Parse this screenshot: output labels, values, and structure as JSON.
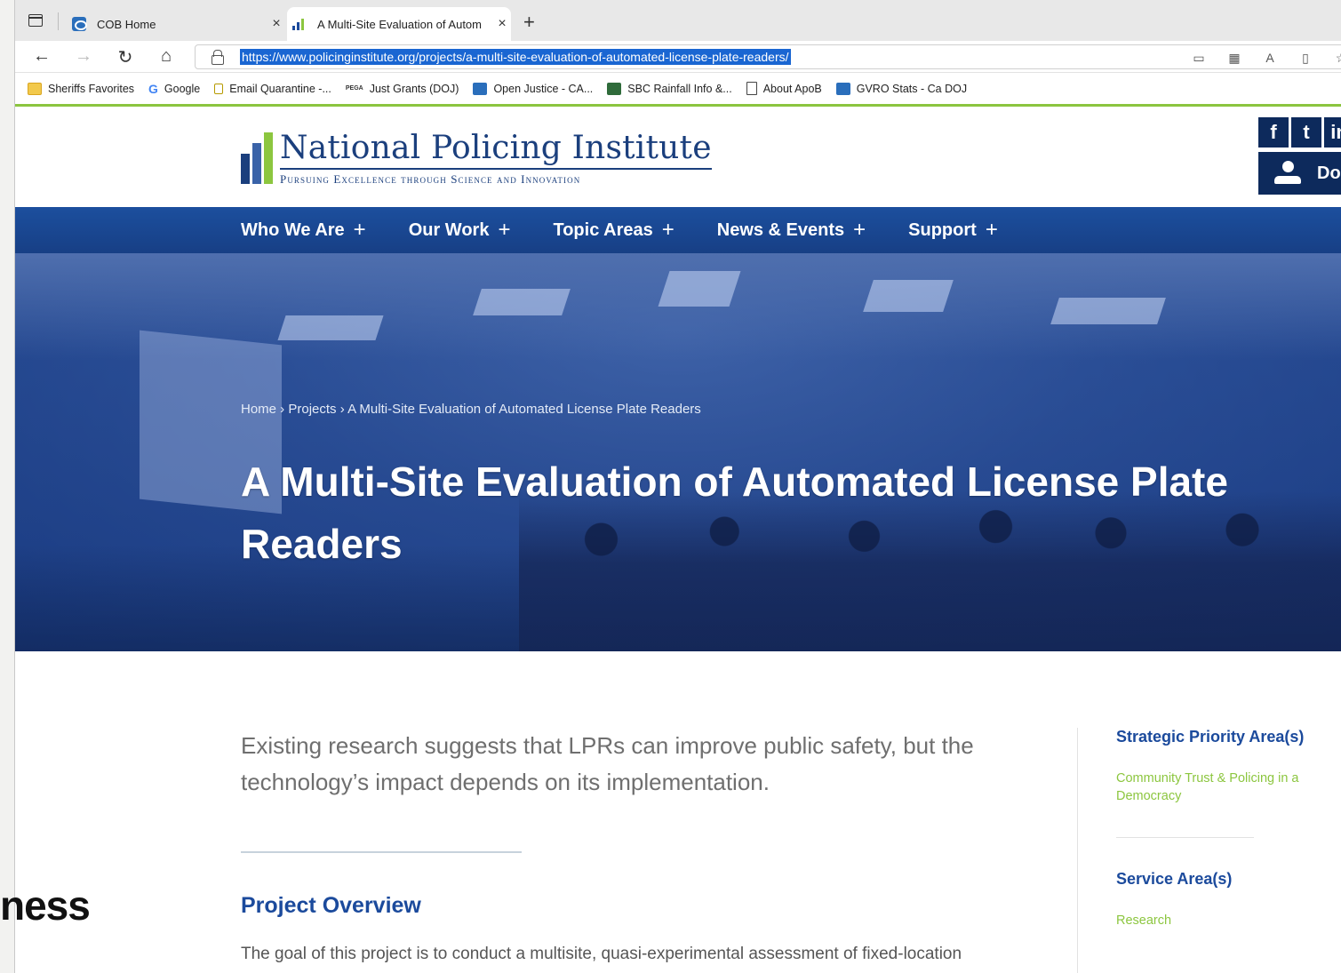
{
  "overlay_text": "ness",
  "browser": {
    "tabs": [
      {
        "title": "COB Home",
        "close": "×"
      },
      {
        "title": "A Multi-Site Evaluation of Autom",
        "close": "×"
      }
    ],
    "new_tab": "+",
    "url": "https://www.policinginstitute.org/projects/a-multi-site-evaluation-of-automated-license-plate-readers/",
    "nav": {
      "back": "←",
      "forward": "→",
      "reload": "↻",
      "home": "⌂"
    },
    "bookmarks": [
      {
        "label": "Sheriffs Favorites",
        "icon": "folder-icon"
      },
      {
        "label": "Google",
        "icon": "google-icon"
      },
      {
        "label": "Email Quarantine -...",
        "icon": "lock-icon"
      },
      {
        "label": "Just Grants (DOJ)",
        "icon": "pega-icon"
      },
      {
        "label": "Open Justice - CA...",
        "icon": "open-justice-icon"
      },
      {
        "label": "SBC Rainfall Info &...",
        "icon": "sbc-icon"
      },
      {
        "label": "About ApoB",
        "icon": "page-icon"
      },
      {
        "label": "GVRO Stats - Ca DOJ",
        "icon": "open-justice-icon"
      }
    ]
  },
  "site": {
    "logo": {
      "name": "National Policing Institute",
      "tagline": "Pursuing Excellence through Science and Innovation"
    },
    "social": {
      "facebook": "f",
      "twitter": "t",
      "linkedin": "in"
    },
    "donate_label": "Don",
    "nav": [
      {
        "label": "Who We Are",
        "plus": "+"
      },
      {
        "label": "Our Work",
        "plus": "+"
      },
      {
        "label": "Topic Areas",
        "plus": "+"
      },
      {
        "label": "News & Events",
        "plus": "+"
      },
      {
        "label": "Support",
        "plus": "+"
      }
    ],
    "breadcrumb": {
      "home": "Home",
      "sep": " › ",
      "projects": "Projects",
      "current": "A Multi-Site Evaluation of Automated License Plate Readers"
    },
    "title": "A Multi-Site Evaluation of Automated License Plate Readers",
    "lead": "Existing research suggests that LPRs can improve public safety, but the technology’s impact depends on its implementation.",
    "overview_heading": "Project Overview",
    "overview_text": "The goal of this project is to conduct a multisite, quasi-experimental assessment of fixed-location",
    "sidebar": {
      "strategic_heading": "Strategic Priority Area(s)",
      "strategic_link": "Community Trust & Policing in a Democracy",
      "service_heading": "Service Area(s)",
      "service_link": "Research"
    }
  },
  "colors": {
    "brand_blue": "#1b4a9c",
    "nav_blue": "#1c4f9e",
    "accent_green": "#8cc63f",
    "url_highlight": "#1a66d2"
  }
}
